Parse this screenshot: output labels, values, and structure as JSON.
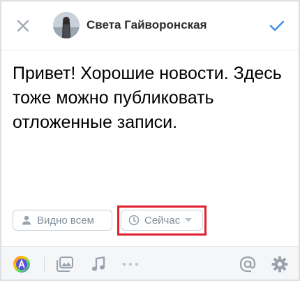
{
  "header": {
    "author_name": "Света Гайворонская",
    "close_icon": "close-icon",
    "done_icon": "checkmark-icon"
  },
  "post": {
    "text": "Привет! Хорошие новости. Здесь тоже можно публиковать отложенные записи."
  },
  "options": {
    "visibility_label": "Видно всем",
    "time_label": "Сейчас"
  },
  "toolbar": {
    "items": [
      "color-palette-icon",
      "photo-icon",
      "music-icon",
      "more-icon",
      "mention-icon",
      "settings-icon"
    ]
  },
  "colors": {
    "accent": "#3f8ae0",
    "icon_gray": "#99a2ad",
    "highlight": "#e0202e"
  }
}
